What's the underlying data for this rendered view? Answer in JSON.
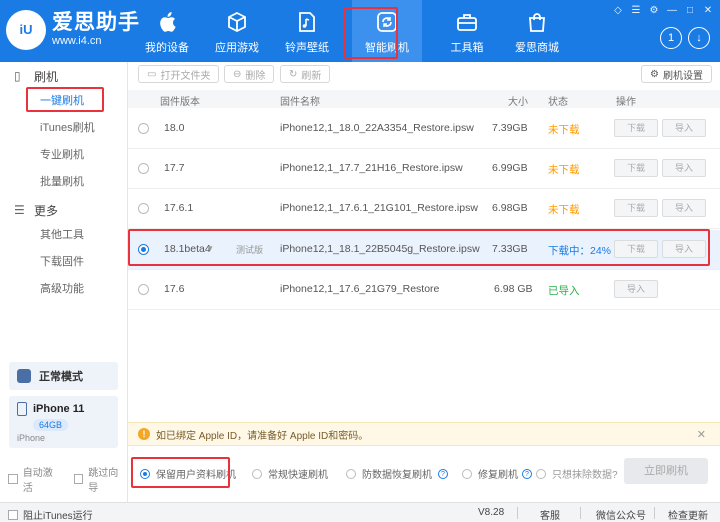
{
  "header": {
    "logo_text": "iU",
    "brand_name": "爱思助手",
    "brand_url": "www.i4.cn",
    "nav": [
      {
        "label": "我的设备"
      },
      {
        "label": "应用游戏"
      },
      {
        "label": "铃声壁纸"
      },
      {
        "label": "智能刷机"
      },
      {
        "label": "工具箱"
      },
      {
        "label": "爱思商城"
      }
    ],
    "badge_number": "1",
    "accent": "#1a7be5"
  },
  "sidebar": {
    "group1": "刷机",
    "group1_items": [
      "一键刷机",
      "iTunes刷机",
      "专业刷机",
      "批量刷机"
    ],
    "group2": "更多",
    "group2_items": [
      "其他工具",
      "下载固件",
      "高级功能"
    ],
    "mode": "正常模式",
    "device_name": "iPhone 11",
    "device_capacity": "64GB",
    "device_type": "iPhone",
    "auto_activate": "自动激活",
    "skip_guide": "跳过向导"
  },
  "toolbar": {
    "open_folder": "打开文件夹",
    "delete": "删除",
    "refresh": "刷新",
    "flash_settings": "刷机设置"
  },
  "table": {
    "headers": {
      "version": "固件版本",
      "name": "固件名称",
      "size": "大小",
      "status": "状态",
      "action": "操作"
    },
    "rows": [
      {
        "version": "18.0",
        "tag": "",
        "name": "iPhone12,1_18.0_22A3354_Restore.ipsw",
        "size": "7.39GB",
        "status": "未下载",
        "btn_download": "下载",
        "btn_import": "导入"
      },
      {
        "version": "17.7",
        "tag": "",
        "name": "iPhone12,1_17.7_21H16_Restore.ipsw",
        "size": "6.99GB",
        "status": "未下载",
        "btn_download": "下载",
        "btn_import": "导入"
      },
      {
        "version": "17.6.1",
        "tag": "",
        "name": "iPhone12,1_17.6.1_21G101_Restore.ipsw",
        "size": "6.98GB",
        "status": "未下载",
        "btn_download": "下载",
        "btn_import": "导入"
      },
      {
        "version": "18.1beta4",
        "tag": "测试版",
        "name": "iPhone12,1_18.1_22B5045g_Restore.ipsw",
        "size": "7.33GB",
        "status": "下载中：24%",
        "btn_download": "下载",
        "btn_import": "导入"
      },
      {
        "version": "17.6",
        "tag": "",
        "name": "iPhone12,1_17.6_21G79_Restore",
        "size": "6.98 GB",
        "status": "已导入",
        "btn_import": "导入"
      }
    ]
  },
  "notice": "如已绑定 Apple ID，请准备好 Apple ID和密码。",
  "options": {
    "keep_data": "保留用户资料刷机",
    "quick": "常规快速刷机",
    "anti_recovery": "防数据恢复刷机",
    "repair": "修复刷机",
    "erase_only": "只想抹除数据?",
    "flash_now": "立即刷机"
  },
  "footer": {
    "block_itunes": "阻止iTunes运行",
    "version": "V8.28",
    "support": "客服",
    "wechat": "微信公众号",
    "update": "检查更新"
  }
}
